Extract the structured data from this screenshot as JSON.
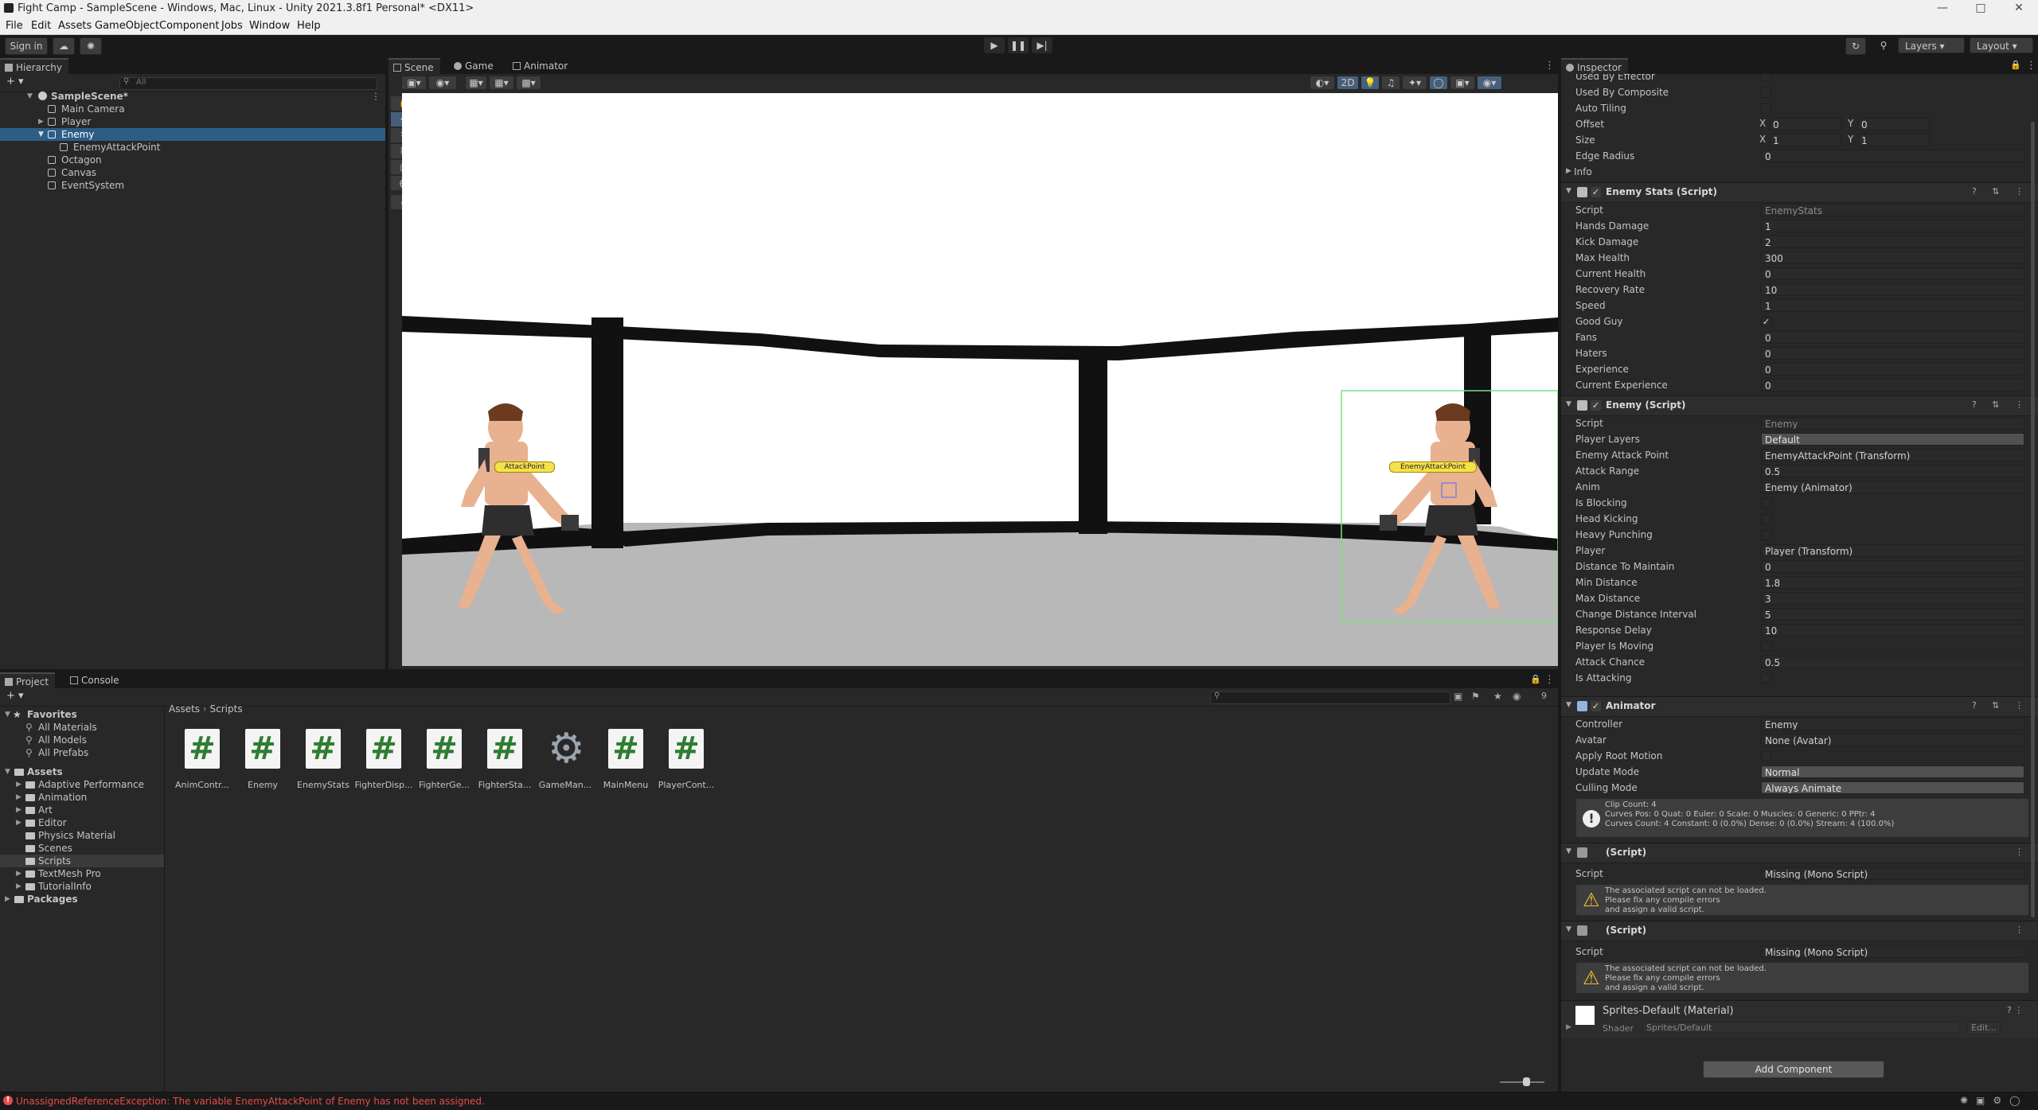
{
  "window": {
    "title": "Fight Camp - SampleScene - Windows, Mac, Linux - Unity 2021.3.8f1 Personal* <DX11>"
  },
  "menu": [
    "File",
    "Edit",
    "Assets",
    "GameObject",
    "Component",
    "Jobs",
    "Window",
    "Help"
  ],
  "toolbar": {
    "sign_in": "Sign in",
    "layers": "Layers",
    "layout": "Layout"
  },
  "hierarchy": {
    "tab": "Hierarchy",
    "search_placeholder": "All",
    "items": [
      {
        "label": "SampleScene*"
      },
      {
        "label": "Main Camera"
      },
      {
        "label": "Player"
      },
      {
        "label": "Enemy"
      },
      {
        "label": "EnemyAttackPoint"
      },
      {
        "label": "Octagon"
      },
      {
        "label": "Canvas"
      },
      {
        "label": "EventSystem"
      }
    ]
  },
  "scene": {
    "tabs": [
      "Scene",
      "Game",
      "Animator"
    ],
    "mode_2d": "2D",
    "labels": {
      "player_attack": "AttackPoint",
      "enemy_attack": "EnemyAttackPoint"
    }
  },
  "project": {
    "tabs": [
      "Project",
      "Console"
    ],
    "favorites": {
      "label": "Favorites",
      "items": [
        "All Materials",
        "All Models",
        "All Prefabs"
      ]
    },
    "assets": {
      "label": "Assets",
      "folders": [
        "Adaptive Performance",
        "Animation",
        "Art",
        "Editor",
        "Physics Material",
        "Scenes",
        "Scripts",
        "TextMesh Pro",
        "TutorialInfo"
      ]
    },
    "packages": "Packages",
    "breadcrumb": [
      "Assets",
      "Scripts"
    ],
    "hidden_count": "9",
    "files": [
      {
        "name": "AnimContr...",
        "icon": "csharp-script-icon"
      },
      {
        "name": "Enemy",
        "icon": "csharp-script-icon"
      },
      {
        "name": "EnemyStats",
        "icon": "csharp-script-icon"
      },
      {
        "name": "FighterDisp...",
        "icon": "csharp-script-icon"
      },
      {
        "name": "FighterGe...",
        "icon": "csharp-script-icon"
      },
      {
        "name": "FighterSta...",
        "icon": "csharp-script-icon"
      },
      {
        "name": "GameMan...",
        "icon": "gear-icon"
      },
      {
        "name": "MainMenu",
        "icon": "csharp-script-icon"
      },
      {
        "name": "PlayerCont...",
        "icon": "csharp-script-icon"
      }
    ]
  },
  "inspector": {
    "tab": "Inspector",
    "collider": {
      "used_by_effector": "Used By Effector",
      "used_by_composite": "Used By Composite",
      "auto_tiling": "Auto Tiling",
      "offset_label": "Offset",
      "offset_x": "0",
      "offset_y": "0",
      "size_label": "Size",
      "size_x": "1",
      "size_y": "1",
      "edge_radius_label": "Edge Radius",
      "edge_radius": "0",
      "info": "Info"
    },
    "enemy_stats": {
      "title": "Enemy Stats (Script)",
      "fields": [
        {
          "label": "Script",
          "value": "EnemyStats"
        },
        {
          "label": "Hands Damage",
          "value": "1"
        },
        {
          "label": "Kick Damage",
          "value": "2"
        },
        {
          "label": "Max Health",
          "value": "300"
        },
        {
          "label": "Current Health",
          "value": "0"
        },
        {
          "label": "Recovery Rate",
          "value": "10"
        },
        {
          "label": "Speed",
          "value": "1"
        },
        {
          "label": "Good Guy",
          "value": "✓"
        },
        {
          "label": "Fans",
          "value": "0"
        },
        {
          "label": "Haters",
          "value": "0"
        },
        {
          "label": "Experience",
          "value": "0"
        },
        {
          "label": "Current Experience",
          "value": "0"
        }
      ]
    },
    "enemy": {
      "title": "Enemy (Script)",
      "fields": [
        {
          "label": "Script",
          "value": "Enemy"
        },
        {
          "label": "Player Layers",
          "value": "Default"
        },
        {
          "label": "Enemy Attack Point",
          "value": "EnemyAttackPoint (Transform)"
        },
        {
          "label": "Attack Range",
          "value": "0.5"
        },
        {
          "label": "Anim",
          "value": "Enemy (Animator)"
        },
        {
          "label": "Is Blocking",
          "value": ""
        },
        {
          "label": "Head Kicking",
          "value": ""
        },
        {
          "label": "Heavy Punching",
          "value": ""
        },
        {
          "label": "Player",
          "value": "Player (Transform)"
        },
        {
          "label": "Distance To Maintain",
          "value": "0"
        },
        {
          "label": "Min Distance",
          "value": "1.8"
        },
        {
          "label": "Max Distance",
          "value": "3"
        },
        {
          "label": "Change Distance Interval",
          "value": "5"
        },
        {
          "label": "Response Delay",
          "value": "10"
        },
        {
          "label": "Player Is Moving",
          "value": ""
        },
        {
          "label": "Attack Chance",
          "value": "0.5"
        },
        {
          "label": "Is Attacking",
          "value": ""
        }
      ]
    },
    "animator": {
      "title": "Animator",
      "fields": [
        {
          "label": "Controller",
          "value": "Enemy"
        },
        {
          "label": "Avatar",
          "value": "None (Avatar)"
        },
        {
          "label": "Apply Root Motion",
          "value": ""
        },
        {
          "label": "Update Mode",
          "value": "Normal"
        },
        {
          "label": "Culling Mode",
          "value": "Always Animate"
        }
      ],
      "info": [
        "Clip Count: 4",
        "Curves Pos: 0 Quat: 0 Euler: 0 Scale: 0 Muscles: 0 Generic: 0 PPtr: 4",
        "Curves Count: 4 Constant: 0 (0.0%) Dense: 0 (0.0%) Stream: 4 (100.0%)"
      ]
    },
    "missing1": {
      "title": "(Script)",
      "script_label": "Script",
      "script_value": "Missing (Mono Script)",
      "warning": [
        "The associated script can not be loaded.",
        "Please fix any compile errors",
        "and assign a valid script."
      ]
    },
    "missing2": {
      "title": "(Script)",
      "script_label": "Script",
      "script_value": "Missing (Mono Script)",
      "warning": [
        "The associated script can not be loaded.",
        "Please fix any compile errors",
        "and assign a valid script."
      ]
    },
    "material": {
      "title": "Sprites-Default (Material)",
      "shader_label": "Shader",
      "shader_value": "Sprites/Default",
      "edit": "Edit..."
    },
    "add_component": "Add Component"
  },
  "status": {
    "error": "UnassignedReferenceException: The variable EnemyAttackPoint of Enemy has not been assigned.",
    "error_color": "#e84b4b"
  }
}
